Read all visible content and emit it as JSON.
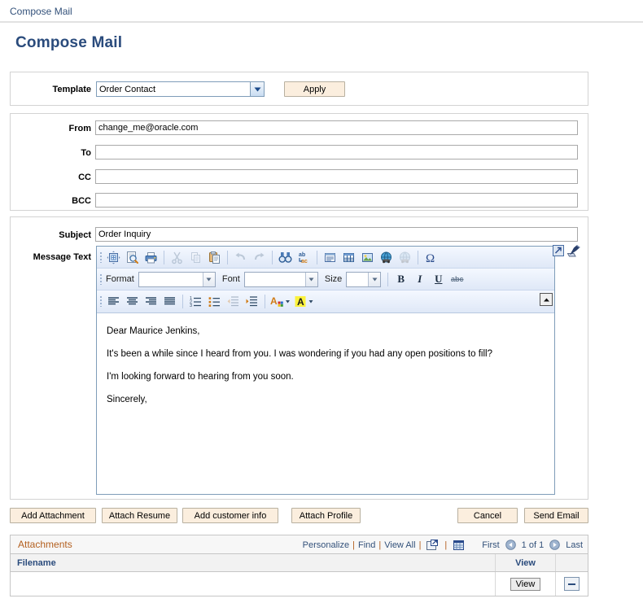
{
  "breadcrumb": {
    "text": "Compose Mail"
  },
  "page": {
    "title": "Compose Mail"
  },
  "template_section": {
    "label": "Template",
    "selected": "Order Contact",
    "apply_label": "Apply"
  },
  "address_section": {
    "from_label": "From",
    "from_value": "change_me@oracle.com",
    "to_label": "To",
    "to_value": "",
    "to_placeholder": "",
    "cc_label": "CC",
    "cc_value": "",
    "cc_placeholder": "",
    "bcc_label": "BCC",
    "bcc_value": "",
    "bcc_placeholder": ""
  },
  "message_section": {
    "subject_label": "Subject",
    "subject_value": "Order Inquiry",
    "message_label": "Message Text"
  },
  "editor": {
    "toolbar_row1": [
      {
        "name": "templates-icon",
        "title": "Templates"
      },
      {
        "name": "preview-icon",
        "title": "Preview"
      },
      {
        "name": "print-icon",
        "title": "Print"
      },
      {
        "name": "cut-icon",
        "title": "Cut",
        "disabled": true
      },
      {
        "name": "copy-icon",
        "title": "Copy",
        "disabled": true
      },
      {
        "name": "paste-icon",
        "title": "Paste"
      },
      {
        "name": "undo-icon",
        "title": "Undo",
        "disabled": true
      },
      {
        "name": "redo-icon",
        "title": "Redo",
        "disabled": true
      },
      {
        "name": "find-icon",
        "title": "Find"
      },
      {
        "name": "replace-icon",
        "title": "Replace"
      },
      {
        "name": "form-icon",
        "title": "Form"
      },
      {
        "name": "table-icon",
        "title": "Table"
      },
      {
        "name": "image-icon",
        "title": "Image"
      },
      {
        "name": "link-icon",
        "title": "Link"
      },
      {
        "name": "unlink-icon",
        "title": "Unlink",
        "disabled": true
      },
      {
        "name": "special-character-icon",
        "title": "Insert Special Character"
      }
    ],
    "format_label": "Format",
    "format_value": "",
    "font_label": "Font",
    "font_value": "",
    "size_label": "Size",
    "size_value": "",
    "bold_label": "B",
    "italic_label": "I",
    "underline_label": "U",
    "strike_label": "abc",
    "toolbar_row3": [
      {
        "name": "align-left-icon",
        "title": "Align Left"
      },
      {
        "name": "align-center-icon",
        "title": "Center"
      },
      {
        "name": "align-right-icon",
        "title": "Align Right"
      },
      {
        "name": "align-justify-icon",
        "title": "Justify"
      },
      {
        "name": "numbered-list-icon",
        "title": "Insert/Remove Numbered List"
      },
      {
        "name": "bulleted-list-icon",
        "title": "Insert/Remove Bulleted List"
      },
      {
        "name": "outdent-icon",
        "title": "Decrease Indent",
        "disabled": true
      },
      {
        "name": "indent-icon",
        "title": "Increase Indent"
      },
      {
        "name": "text-color-icon",
        "title": "Text Color"
      },
      {
        "name": "background-color-icon",
        "title": "Background Color"
      }
    ],
    "body_paragraphs": [
      "Dear Maurice Jenkins,",
      "It's been a while since I heard from you.  I was wondering if you had any open positions to fill?",
      "I'm looking forward to hearing from you soon.",
      "Sincerely,"
    ],
    "expand_icon": "expand-editor-icon",
    "spellcheck_icon": "spell-check-icon",
    "scroll_up_icon": "scroll-up-icon"
  },
  "actions": {
    "add_attachment": "Add Attachment",
    "attach_resume": "Attach Resume",
    "add_customer_info": "Add customer info",
    "attach_profile": "Attach Profile",
    "cancel": "Cancel",
    "send_email": "Send Email"
  },
  "attachments": {
    "title": "Attachments",
    "personalize": "Personalize",
    "find": "Find",
    "view_all": "View All",
    "export_icon": "export-to-excel-icon",
    "grid_icon": "zoom-grid-icon",
    "first_label": "First",
    "prev_icon": "previous-page-icon",
    "page_indicator": "1 of 1",
    "next_icon": "next-page-icon",
    "last_label": "Last",
    "columns": [
      "Filename",
      "View",
      ""
    ],
    "rows": [
      {
        "filename": "",
        "view_label": "View",
        "delete_icon": "delete-row-icon"
      }
    ]
  },
  "colors": {
    "accent_blue": "#2a4b7c",
    "link_blue": "#33517a",
    "grid_title_orange": "#b35f1e",
    "button_face": "#fbeede"
  }
}
